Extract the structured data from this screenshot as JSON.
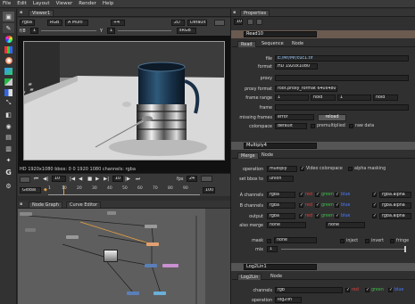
{
  "menu": [
    "File",
    "Edit",
    "Layout",
    "Viewer",
    "Render",
    "Help"
  ],
  "toolbar_icons": [
    "pointer-icon",
    "paint-icon",
    "color-wheel-icon",
    "channel-icon",
    "color-icon",
    "filter-icon",
    "keyer-icon",
    "merge-icon",
    "transform-icon",
    "3d-icon",
    "views-icon",
    "metadata-icon",
    "other-icon",
    "gizmo-icon",
    "g-icon"
  ],
  "toolbar_g": "G",
  "viewer": {
    "tab": "Viewer1",
    "rgba": "rgba",
    "rgb": "RGB",
    "multi": "A Multi",
    "zoom": "+4",
    "mode": "2D",
    "default": "Default",
    "gain_label": "f/8",
    "gain_val": "1",
    "y_label": "Y",
    "gamma_val": "1",
    "lut": "sRGB",
    "info": "HD 1920x1080  bbox: 0 0 1920 1080 channels: rgba",
    "frame": "10",
    "fps": "24",
    "global": "Global",
    "frame_start": "1",
    "frame_end": "100",
    "ruler": [
      "1",
      "10",
      "20",
      "30",
      "40",
      "50",
      "60",
      "70",
      "80",
      "90",
      "100"
    ],
    "step": "10",
    "global_end": "100"
  },
  "nodegraph": {
    "tabs": [
      "Node Graph",
      "Curve Editor"
    ]
  },
  "properties": {
    "title": "Properties",
    "count": "10",
    "read": {
      "name": "Read10",
      "tabs": [
        "Read",
        "Sequence",
        "Node"
      ],
      "file_label": "file",
      "file_value": "E:/Mr/Mr/cuc1.tif",
      "format_label": "format",
      "format_value": "HD 1920x1080",
      "proxy_label": "proxy",
      "proxy_format_label": "proxy format",
      "proxy_format_value": "root.proxy_format 640x480",
      "frame_range_label": "frame range",
      "frame_range_start": "1",
      "frame_range_hold1": "hold",
      "frame_range_end": "1",
      "frame_range_hold2": "hold",
      "frame_label": "frame",
      "missing_frames_label": "missing frames",
      "missing_frames_value": "error",
      "reload_label": "reload",
      "colorspace_label": "colorspace",
      "colorspace_value": "default",
      "premultiplied_label": "premultiplied",
      "raw_data_label": "raw data"
    },
    "multiply": {
      "name": "Multiply4",
      "tabs": [
        "Merge",
        "Node"
      ],
      "operation_label": "operation",
      "operation_value": "multiply",
      "video_colorspace_label": "Video colorspace",
      "alpha_masking_label": "alpha masking",
      "set_bbox_label": "set bbox to",
      "set_bbox_value": "union",
      "a_channels_label": "A channels",
      "b_channels_label": "B channels",
      "output_label": "output",
      "also_merge_label": "also merge",
      "channels_value": "rgba",
      "also_merge_value": "none",
      "also_merge_value2": "none",
      "red": "red",
      "green": "green",
      "blue": "blue",
      "alpha_dd": "rgba.alpha",
      "mask_label": "mask",
      "mask_value": "none",
      "inject_label": "inject",
      "invert_label": "invert",
      "fringe_label": "fringe",
      "mix_label": "mix",
      "mix_value": "1"
    },
    "log2lin": {
      "name": "Log2Lin1",
      "tabs": [
        "Log2Lin",
        "Node"
      ],
      "channels_label": "channels",
      "channels_value": "rgb",
      "operation_label": "operation",
      "operation_value": "log2lin",
      "red": "red",
      "green": "green",
      "blue": "blue"
    }
  },
  "colors": {
    "red": "#e24040",
    "green": "#3fc04a",
    "blue": "#4a7cff",
    "accent": "#e8a040",
    "node_blue": "#5a7fb8"
  }
}
